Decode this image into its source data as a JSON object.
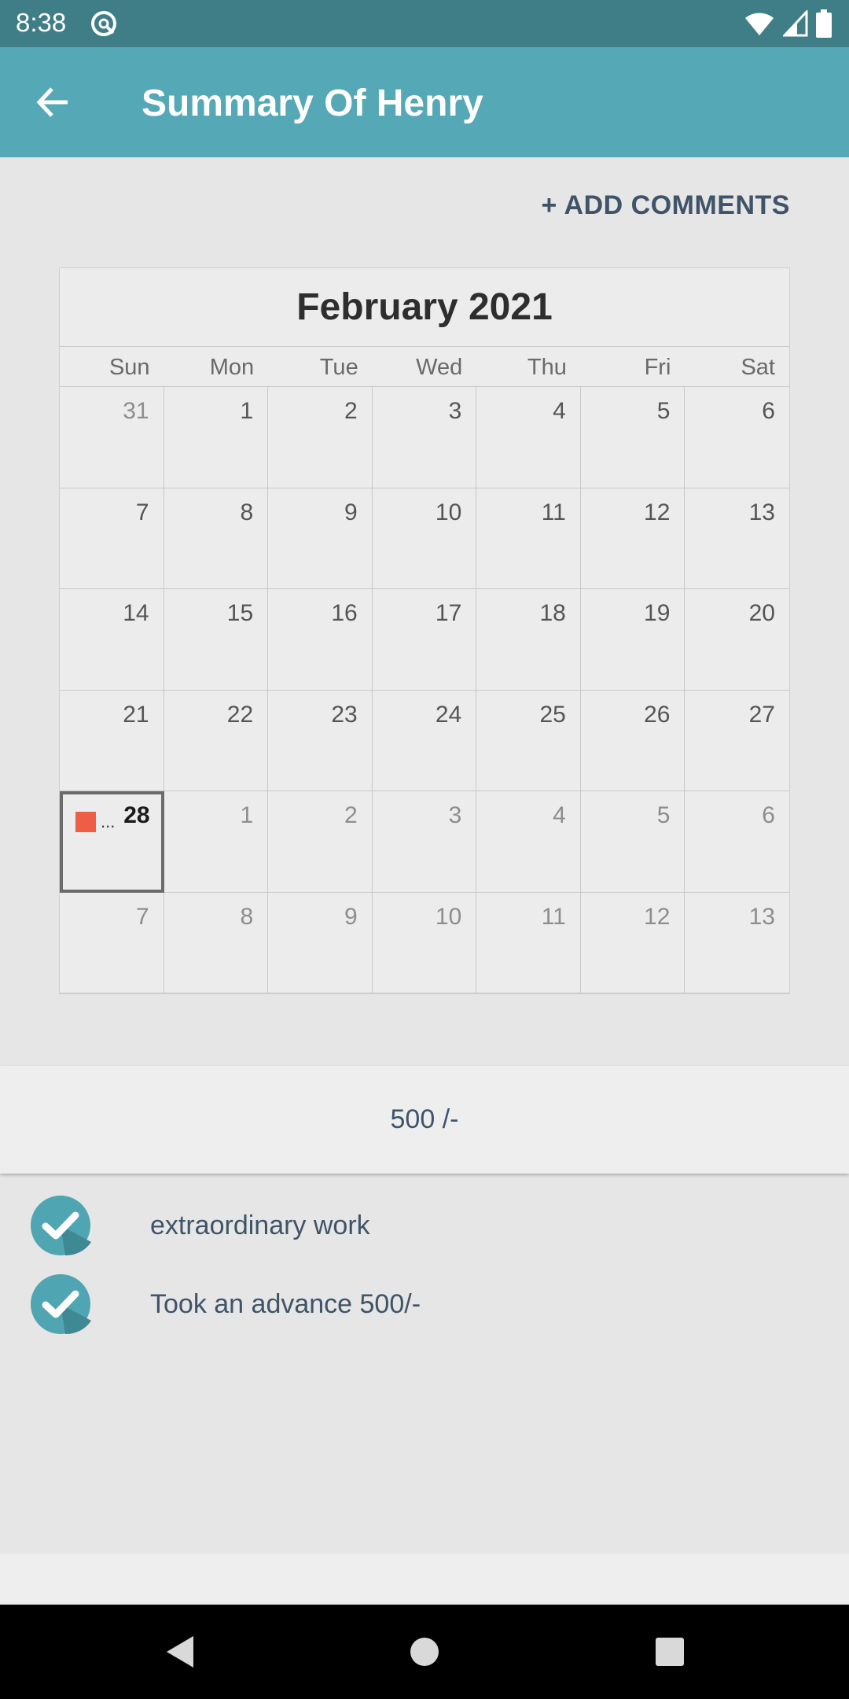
{
  "status_bar": {
    "time": "8:38",
    "app_icon": "at-sign-icon",
    "icons": [
      "wifi-icon",
      "signal-icon",
      "battery-icon"
    ]
  },
  "app_bar": {
    "title": "Summary Of Henry",
    "back_icon": "arrow-left-icon"
  },
  "actions": {
    "add_comments_label": "+ ADD COMMENTS"
  },
  "calendar": {
    "title": "February 2021",
    "weekdays": [
      "Sun",
      "Mon",
      "Tue",
      "Wed",
      "Thu",
      "Fri",
      "Sat"
    ],
    "weeks": [
      [
        {
          "d": "31",
          "o": true
        },
        {
          "d": "1"
        },
        {
          "d": "2"
        },
        {
          "d": "3"
        },
        {
          "d": "4"
        },
        {
          "d": "5"
        },
        {
          "d": "6"
        }
      ],
      [
        {
          "d": "7"
        },
        {
          "d": "8"
        },
        {
          "d": "9"
        },
        {
          "d": "10"
        },
        {
          "d": "11"
        },
        {
          "d": "12"
        },
        {
          "d": "13"
        }
      ],
      [
        {
          "d": "14"
        },
        {
          "d": "15"
        },
        {
          "d": "16"
        },
        {
          "d": "17"
        },
        {
          "d": "18"
        },
        {
          "d": "19"
        },
        {
          "d": "20"
        }
      ],
      [
        {
          "d": "21"
        },
        {
          "d": "22"
        },
        {
          "d": "23"
        },
        {
          "d": "24"
        },
        {
          "d": "25"
        },
        {
          "d": "26"
        },
        {
          "d": "27"
        }
      ],
      [
        {
          "d": "28",
          "selected": true,
          "event": true
        },
        {
          "d": "1",
          "o": true
        },
        {
          "d": "2",
          "o": true
        },
        {
          "d": "3",
          "o": true
        },
        {
          "d": "4",
          "o": true
        },
        {
          "d": "5",
          "o": true
        },
        {
          "d": "6",
          "o": true
        }
      ],
      [
        {
          "d": "7",
          "o": true
        },
        {
          "d": "8",
          "o": true
        },
        {
          "d": "9",
          "o": true
        },
        {
          "d": "10",
          "o": true
        },
        {
          "d": "11",
          "o": true
        },
        {
          "d": "12",
          "o": true
        },
        {
          "d": "13",
          "o": true
        }
      ]
    ],
    "event_color": "#ee5e47",
    "event_ellipsis": "..."
  },
  "summary": {
    "amount": "500 /-"
  },
  "comments": [
    {
      "text": "extraordinary work",
      "icon": "check-circle-icon"
    },
    {
      "text": "Took an advance 500/-",
      "icon": "check-circle-icon"
    }
  ],
  "colors": {
    "status_bar": "#3f7e87",
    "app_bar": "#55a8b5",
    "accent_text": "#3f5468",
    "check_badge": "#4fa5b1"
  }
}
